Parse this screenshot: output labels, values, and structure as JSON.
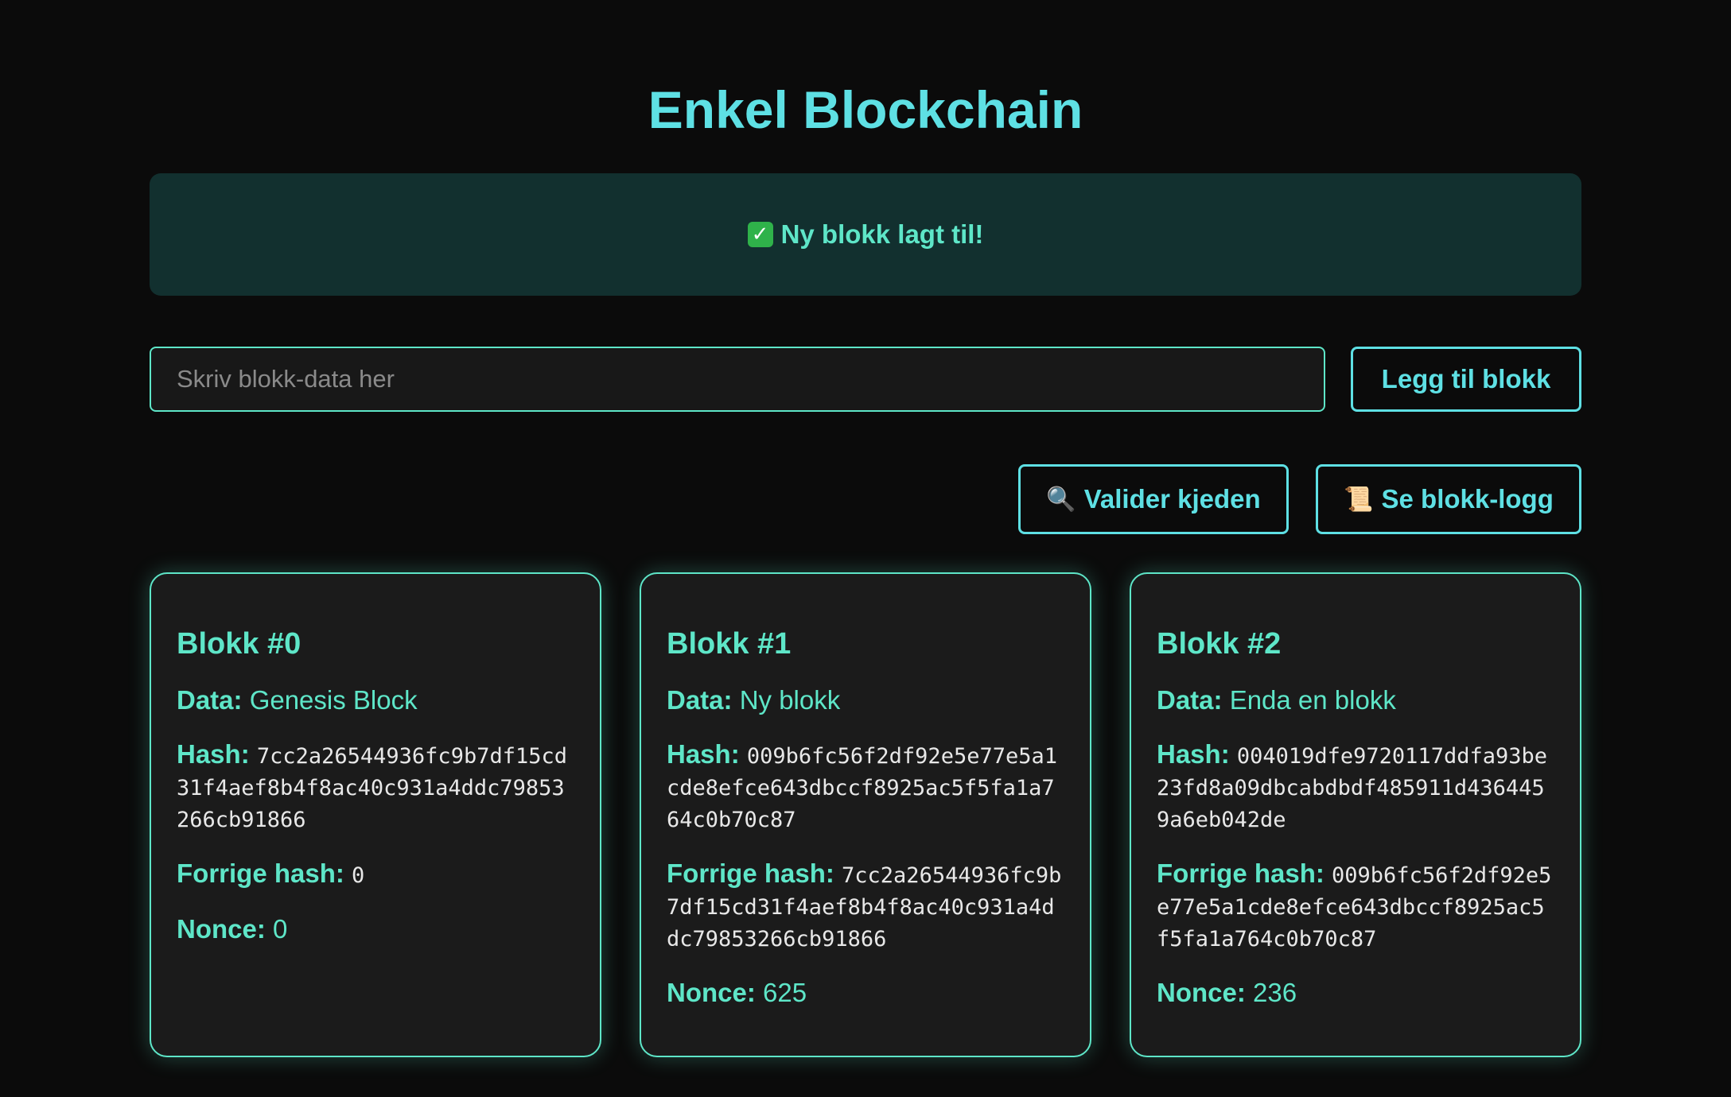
{
  "page": {
    "title": "Enkel Blockchain"
  },
  "notice": {
    "icon": "check-mark-emoji",
    "check_glyph": "✓",
    "text": "Ny blokk lagt til!"
  },
  "form": {
    "input_placeholder": "Skriv blokk-data her",
    "input_value": "",
    "add_button_label": "Legg til blokk"
  },
  "actions": {
    "validate": {
      "icon": "magnifier-emoji",
      "icon_glyph": "🔍",
      "label": "Valider kjeden"
    },
    "log": {
      "icon": "scroll-emoji",
      "icon_glyph": "📜",
      "label": "Se blokk-logg"
    }
  },
  "labels": {
    "data": "Data:",
    "hash": "Hash:",
    "previous_hash": "Forrige hash:",
    "nonce": "Nonce:"
  },
  "blocks": [
    {
      "title": "Blokk #0",
      "data": "Genesis Block",
      "hash": "7cc2a26544936fc9b7df15cd31f4aef8b4f8ac40c931a4ddc79853266cb91866",
      "previous_hash": "0",
      "nonce": "0"
    },
    {
      "title": "Blokk #1",
      "data": "Ny blokk",
      "hash": "009b6fc56f2df92e5e77e5a1cde8efce643dbccf8925ac5f5fa1a764c0b70c87",
      "previous_hash": "7cc2a26544936fc9b7df15cd31f4aef8b4f8ac40c931a4ddc79853266cb91866",
      "nonce": "625"
    },
    {
      "title": "Blokk #2",
      "data": "Enda en blokk",
      "hash": "004019dfe9720117ddfa93be23fd8a09dbcabdbdf485911d4364459a6eb042de",
      "previous_hash": "009b6fc56f2df92e5e77e5a1cde8efce643dbccf8925ac5f5fa1a764c0b70c87",
      "nonce": "236"
    }
  ],
  "colors": {
    "background": "#0b0b0b",
    "accent": "#5ee0e4",
    "text_green": "#5ee6c8",
    "notice_bg": "#12302f",
    "card_bg": "#1b1b1b"
  }
}
